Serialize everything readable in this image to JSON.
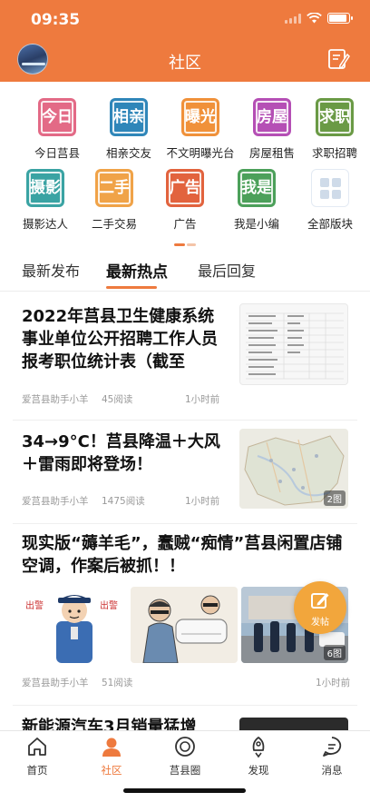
{
  "status_bar": {
    "time": "09:35"
  },
  "header": {
    "title": "社区"
  },
  "categories": [
    {
      "label": "今日莒县",
      "glyph": "今日",
      "color": "#e36a86"
    },
    {
      "label": "相亲交友",
      "glyph": "相亲",
      "color": "#2f86b9"
    },
    {
      "label": "不文明曝光台",
      "glyph": "曝光",
      "color": "#f0913a"
    },
    {
      "label": "房屋租售",
      "glyph": "房屋",
      "color": "#b54fb5"
    },
    {
      "label": "求职招聘",
      "glyph": "求职",
      "color": "#6a9a45"
    },
    {
      "label": "摄影达人",
      "glyph": "摄影",
      "color": "#3aa3a3"
    },
    {
      "label": "二手交易",
      "glyph": "二手",
      "color": "#f0a348"
    },
    {
      "label": "广告",
      "glyph": "广告",
      "color": "#e2633e"
    },
    {
      "label": "我是小编",
      "glyph": "我是",
      "color": "#4ca05a"
    },
    {
      "label": "全部版块",
      "glyph": "",
      "color": "#ffffff"
    }
  ],
  "tabs": [
    {
      "label": "最新发布"
    },
    {
      "label": "最新热点"
    },
    {
      "label": "最后回复"
    }
  ],
  "posts": [
    {
      "title": "2022年莒县卫生健康系统事业单位公开招聘工作人员报考职位统计表（截至",
      "author": "爱莒县助手小羊",
      "reads": "45阅读",
      "time": "1小时前"
    },
    {
      "title": "34→9°C！莒县降温＋大风＋雷雨即将登场！",
      "author": "爱莒县助手小羊",
      "reads": "1475阅读",
      "time": "1小时前",
      "badge": "2图"
    },
    {
      "title": "现实版“薅羊毛”，蠢贼“痴情”莒县闲置店铺空调，作案后被抓！！",
      "author": "爱莒县助手小羊",
      "reads": "51阅读",
      "time": "1小时前",
      "badge": "6图"
    },
    {
      "title": "新能源汽车3月销量猛增"
    }
  ],
  "fab": {
    "label": "发帖"
  },
  "tabbar": [
    {
      "label": "首页"
    },
    {
      "label": "社区"
    },
    {
      "label": "莒县圈"
    },
    {
      "label": "发现"
    },
    {
      "label": "消息"
    }
  ],
  "colors": {
    "accent": "#ee7a3e",
    "fab": "#f2a63c"
  }
}
